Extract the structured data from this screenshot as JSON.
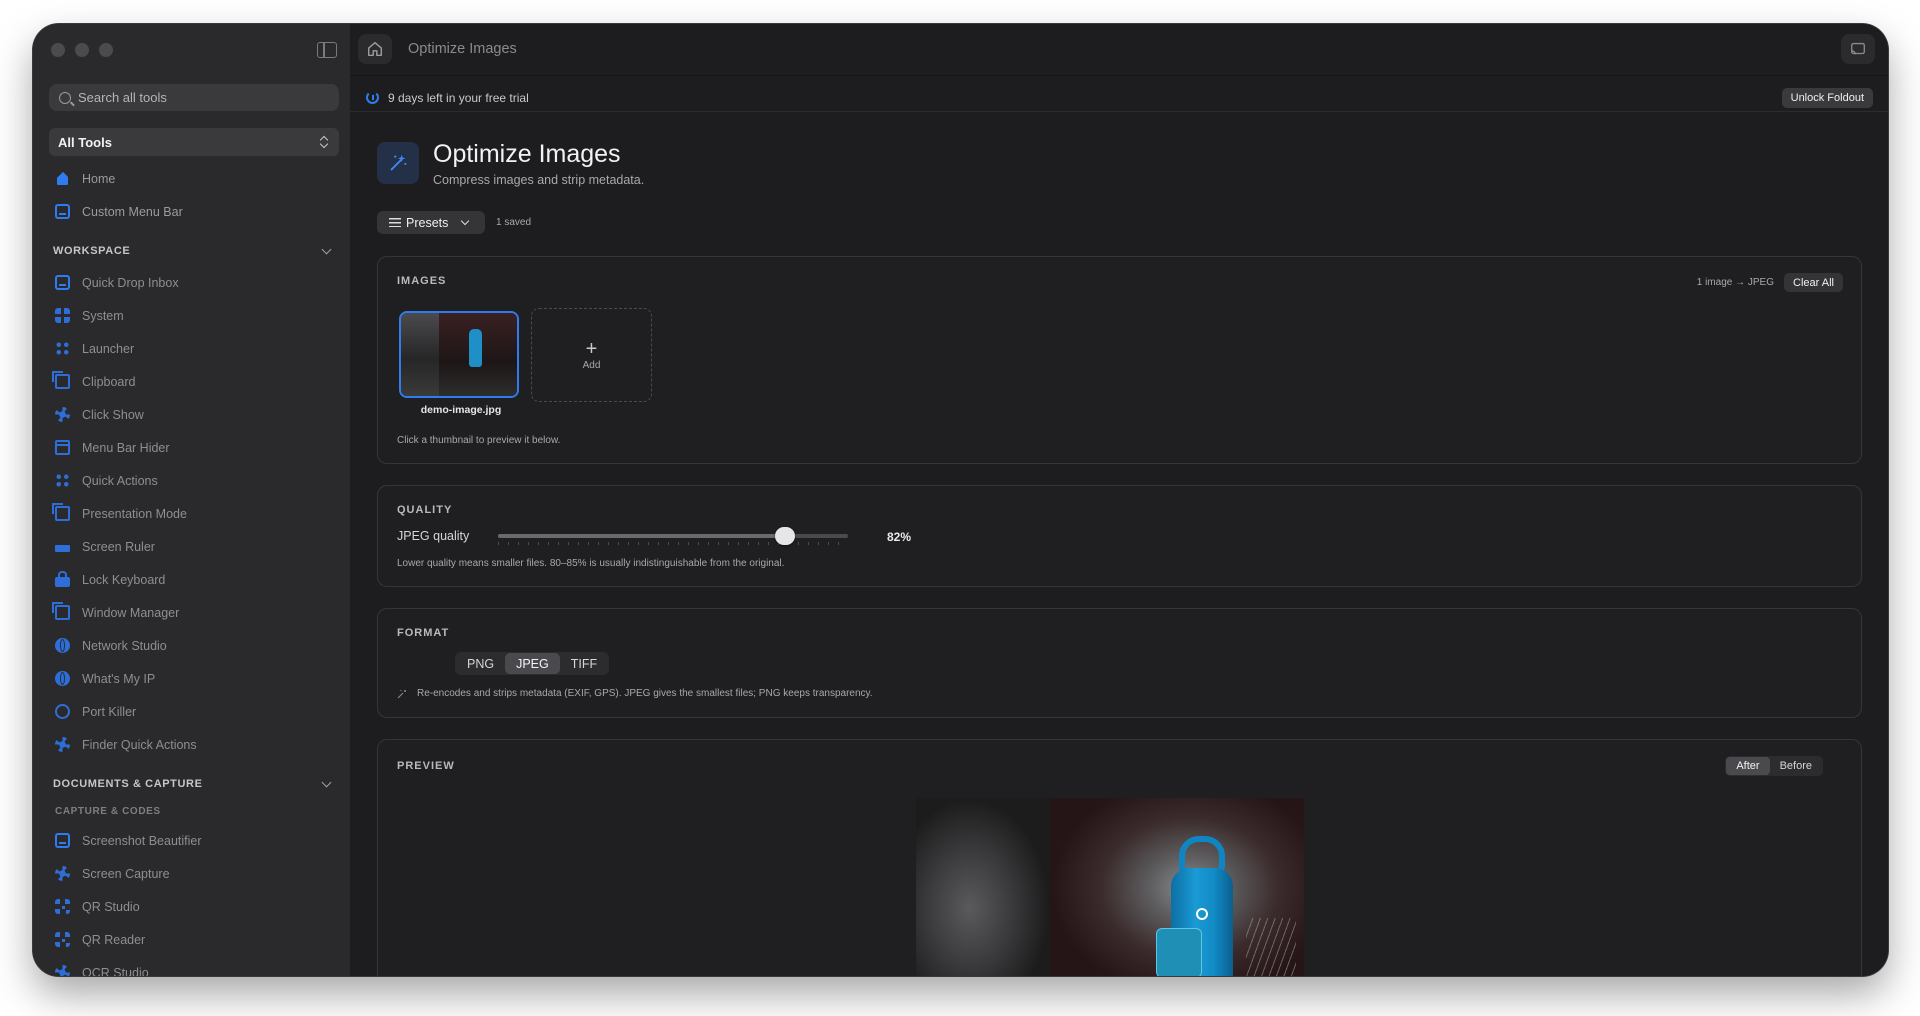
{
  "window": {
    "title": "Optimize Images"
  },
  "sidebar": {
    "search_placeholder": "Search all tools",
    "category_select": "All Tools",
    "top_items": [
      {
        "label": "Home",
        "icon": "house-icon"
      },
      {
        "label": "Custom Menu Bar",
        "icon": "menubar-icon"
      }
    ],
    "workspace": {
      "title": "WORKSPACE",
      "items": [
        {
          "label": "Quick Drop Inbox",
          "icon": "tray-icon"
        },
        {
          "label": "System",
          "icon": "grid-icon"
        },
        {
          "label": "Launcher",
          "icon": "command-icon"
        },
        {
          "label": "Clipboard",
          "icon": "clipboard-icon"
        },
        {
          "label": "Click Show",
          "icon": "click-icon"
        },
        {
          "label": "Menu Bar Hider",
          "icon": "window-icon"
        },
        {
          "label": "Quick Actions",
          "icon": "dots-icon"
        },
        {
          "label": "Presentation Mode",
          "icon": "presentation-icon"
        },
        {
          "label": "Screen Ruler",
          "icon": "ruler-icon"
        },
        {
          "label": "Lock Keyboard",
          "icon": "lock-icon"
        },
        {
          "label": "Window Manager",
          "icon": "windows-icon"
        },
        {
          "label": "Network Studio",
          "icon": "globe-icon"
        },
        {
          "label": "What's My IP",
          "icon": "globe-icon"
        },
        {
          "label": "Port Killer",
          "icon": "ring-icon"
        },
        {
          "label": "Finder Quick Actions",
          "icon": "sparkle-icon"
        }
      ]
    },
    "documents": {
      "title": "DOCUMENTS & CAPTURE",
      "subheader": "CAPTURE & CODES",
      "items": [
        {
          "label": "Screenshot Beautifier",
          "icon": "image-icon"
        },
        {
          "label": "Screen Capture",
          "icon": "capture-icon"
        },
        {
          "label": "QR Studio",
          "icon": "qr-icon"
        },
        {
          "label": "QR Reader",
          "icon": "qr-scan-icon"
        },
        {
          "label": "OCR Studio",
          "icon": "ocr-icon"
        }
      ]
    }
  },
  "trial": {
    "text": "9 days left in your free trial",
    "unlock_label": "Unlock Foldout"
  },
  "tool": {
    "title": "Optimize Images",
    "subtitle": "Compress images and strip metadata.",
    "presets_label": "Presets",
    "saved_text": "1 saved"
  },
  "images": {
    "label": "IMAGES",
    "meta": "1 image → JPEG",
    "clear_label": "Clear All",
    "thumbnail_name": "demo-image.jpg",
    "add_label": "Add",
    "add_symbol": "+",
    "hint": "Click a thumbnail to preview it below."
  },
  "quality": {
    "label": "QUALITY",
    "field_label": "JPEG quality",
    "value_percent": 82,
    "value_text": "82%",
    "hint": "Lower quality means smaller files. 80–85% is usually indistinguishable from the original."
  },
  "format": {
    "label": "FORMAT",
    "options": [
      "PNG",
      "JPEG",
      "TIFF"
    ],
    "selected": "JPEG",
    "hint": "Re-encodes and strips metadata (EXIF, GPS). JPEG gives the smallest files; PNG keeps transparency."
  },
  "preview": {
    "label": "PREVIEW",
    "toggle_after": "After",
    "toggle_before": "Before",
    "selected": "After"
  },
  "colors": {
    "accent": "#2e7cf0",
    "background": "#1d1d1f",
    "sidebar": "#2a2a2c"
  }
}
